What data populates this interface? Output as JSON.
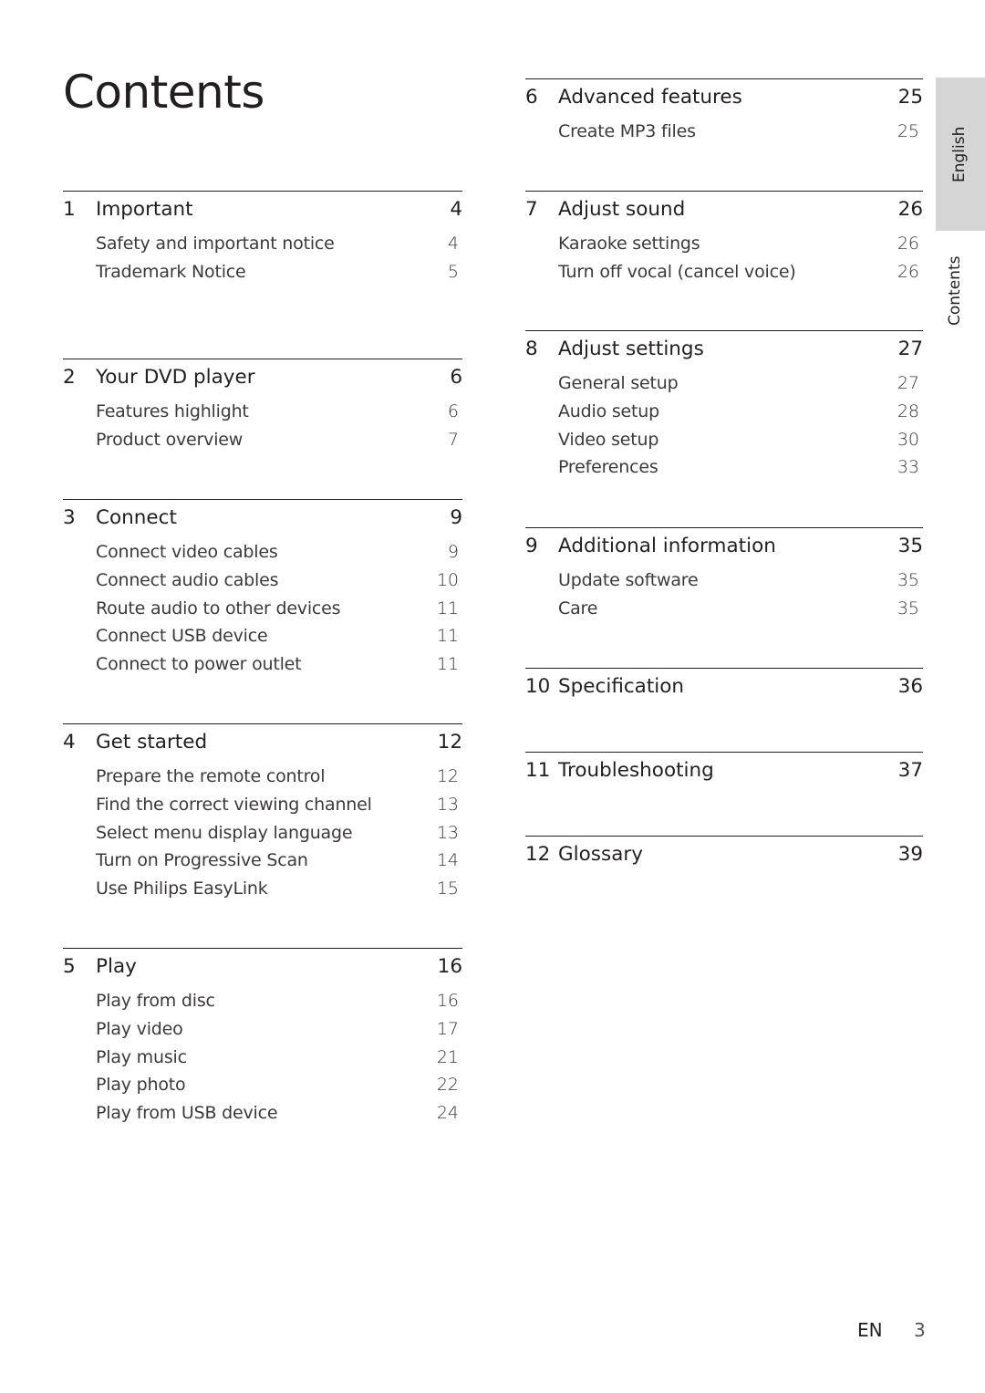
{
  "page": {
    "title": "Contents",
    "side_tabs": {
      "language": "English",
      "section": "Contents"
    },
    "footer": {
      "lang_code": "EN",
      "page_number": "3"
    }
  },
  "toc": {
    "left": [
      {
        "num": "1",
        "title": "Important",
        "page": "4",
        "items": [
          {
            "title": "Safety and important notice",
            "page": "4"
          },
          {
            "title": "Trademark Notice",
            "page": "5"
          }
        ]
      },
      {
        "num": "2",
        "title": "Your DVD player",
        "page": "6",
        "items": [
          {
            "title": "Features highlight",
            "page": "6"
          },
          {
            "title": "Product overview",
            "page": "7"
          }
        ]
      },
      {
        "num": "3",
        "title": "Connect",
        "page": "9",
        "items": [
          {
            "title": "Connect video cables",
            "page": "9"
          },
          {
            "title": "Connect audio cables",
            "page": "10"
          },
          {
            "title": "Route audio to other devices",
            "page": "11"
          },
          {
            "title": "Connect USB device",
            "page": "11"
          },
          {
            "title": "Connect to power outlet",
            "page": "11"
          }
        ]
      },
      {
        "num": "4",
        "title": "Get started",
        "page": "12",
        "items": [
          {
            "title": "Prepare the remote control",
            "page": "12"
          },
          {
            "title": "Find the correct viewing channel",
            "page": "13"
          },
          {
            "title": "Select menu display language",
            "page": "13"
          },
          {
            "title": "Turn on Progressive Scan",
            "page": "14"
          },
          {
            "title": "Use Philips EasyLink",
            "page": "15"
          }
        ]
      },
      {
        "num": "5",
        "title": "Play",
        "page": "16",
        "items": [
          {
            "title": "Play from disc",
            "page": "16"
          },
          {
            "title": "Play video",
            "page": "17"
          },
          {
            "title": "Play music",
            "page": "21"
          },
          {
            "title": "Play photo",
            "page": "22"
          },
          {
            "title": "Play from USB device",
            "page": "24"
          }
        ]
      }
    ],
    "right": [
      {
        "num": "6",
        "title": "Advanced features",
        "page": "25",
        "items": [
          {
            "title": "Create MP3 files",
            "page": "25"
          }
        ]
      },
      {
        "num": "7",
        "title": "Adjust sound",
        "page": "26",
        "items": [
          {
            "title": "Karaoke settings",
            "page": "26"
          },
          {
            "title": "Turn off vocal (cancel voice)",
            "page": "26"
          }
        ]
      },
      {
        "num": "8",
        "title": "Adjust settings",
        "page": "27",
        "items": [
          {
            "title": "General setup",
            "page": "27"
          },
          {
            "title": "Audio setup",
            "page": "28"
          },
          {
            "title": "Video setup",
            "page": "30"
          },
          {
            "title": "Preferences",
            "page": "33"
          }
        ]
      },
      {
        "num": "9",
        "title": "Additional information",
        "page": "35",
        "items": [
          {
            "title": "Update software",
            "page": "35"
          },
          {
            "title": "Care",
            "page": "35"
          }
        ]
      },
      {
        "num": "10",
        "title": "Specification",
        "page": "36",
        "items": []
      },
      {
        "num": "11",
        "title": "Troubleshooting",
        "page": "37",
        "items": []
      },
      {
        "num": "12",
        "title": "Glossary",
        "page": "39",
        "items": []
      }
    ]
  }
}
